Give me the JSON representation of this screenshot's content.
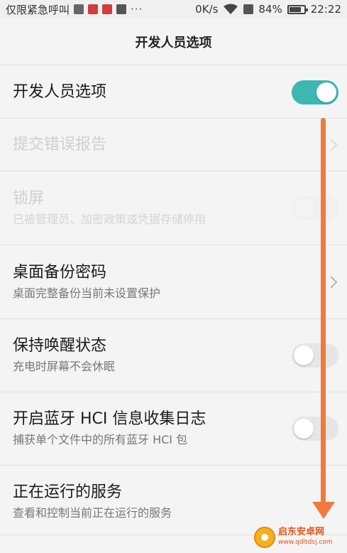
{
  "status_bar": {
    "carrier": "仅限紧急呼叫",
    "dots": "···",
    "speed": "0K/s",
    "battery": "84%",
    "time": "22:22"
  },
  "header": {
    "title": "开发人员选项"
  },
  "settings": [
    {
      "title": "开发人员选项",
      "control": "toggle",
      "state": "on"
    },
    {
      "title": "提交错误报告",
      "control": "chevron",
      "state": "disabled"
    },
    {
      "title": "锁屏",
      "subtitle": "已被管理员、加密政策或凭据存储停用",
      "control": "toggle",
      "state": "disabled"
    },
    {
      "title": "桌面备份密码",
      "subtitle": "桌面完整备份当前未设置保护",
      "control": "chevron"
    },
    {
      "title": "保持唤醒状态",
      "subtitle": "充电时屏幕不会休眠",
      "control": "toggle",
      "state": "off"
    },
    {
      "title": "开启蓝牙 HCI 信息收集日志",
      "subtitle": "捕获单个文件中的所有蓝牙 HCI 包",
      "control": "toggle",
      "state": "off"
    },
    {
      "title": "正在运行的服务",
      "subtitle": "查看和控制当前正在运行的服务"
    }
  ],
  "watermark": {
    "name": "启东安卓网",
    "url": "www.qdltdsj.com"
  },
  "colors": {
    "toggle_on": "#3cb7b3",
    "annotation_arrow": "#f07a3c"
  }
}
